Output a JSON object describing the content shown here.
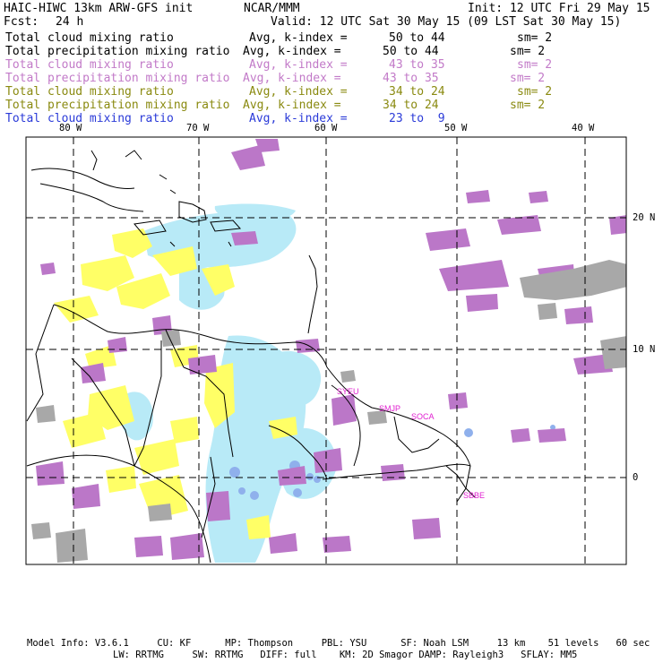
{
  "header": {
    "title": "HAIC-HIWC 13km ARW-GFS init",
    "center": "NCAR/MMM",
    "init": "Init: 12 UTC Fri 29 May 15",
    "fcst_label": "Fcst:",
    "fcst_value": "24 h",
    "valid": "Valid: 12 UTC Sat 30 May 15 (09 LST Sat 30 May 15)"
  },
  "fields": [
    {
      "name": "Total cloud mixing ratio",
      "avg": "Avg, k-index =",
      "range": "50 to 44",
      "sm": "sm= 2",
      "color": "#000000"
    },
    {
      "name": "Total precipitation mixing ratio",
      "avg": "Avg, k-index =",
      "range": "50 to 44",
      "sm": "sm= 2",
      "color": "#000000"
    },
    {
      "name": "Total cloud mixing ratio",
      "avg": "Avg, k-index =",
      "range": "43 to 35",
      "sm": "sm= 2",
      "color": "#c27ac8"
    },
    {
      "name": "Total precipitation mixing ratio",
      "avg": "Avg, k-index =",
      "range": "43 to 35",
      "sm": "sm= 2",
      "color": "#c27ac8"
    },
    {
      "name": "Total cloud mixing ratio",
      "avg": "Avg, k-index =",
      "range": "34 to 24",
      "sm": "sm= 2",
      "color": "#8a8a10"
    },
    {
      "name": "Total precipitation mixing ratio",
      "avg": "Avg, k-index =",
      "range": "34 to 24",
      "sm": "sm= 2",
      "color": "#8a8a10"
    },
    {
      "name": "Total cloud mixing ratio",
      "avg": "Avg, k-index =",
      "range": "23 to  9",
      "sm": "",
      "color": "#2a3ad8"
    }
  ],
  "map": {
    "lon_labels": [
      "80 W",
      "70 W",
      "60 W",
      "50 W",
      "40 W"
    ],
    "lat_labels": [
      "20 N",
      "10 N",
      "0"
    ],
    "stations": [
      {
        "code": "SYEU",
        "color": "#e020d0"
      },
      {
        "code": "SMJP",
        "color": "#e020d0"
      },
      {
        "code": "SOCA",
        "color": "#e020d0"
      },
      {
        "code": "SBBE",
        "color": "#e020d0"
      }
    ],
    "colors": {
      "cloud_low": "#b3e8f6",
      "precip_mid": "#ffff66",
      "cloud_mid": "#bb77c8",
      "gray": "#a8a8a8",
      "blue_core": "#8fb6ee"
    }
  },
  "footer": {
    "line1": "Model Info: V3.6.1     CU: KF      MP: Thompson     PBL: YSU      SF: Noah LSM     13 km    51 levels   60 sec",
    "line2": "LW: RRTMG     SW: RRTMG   DIFF: full    KM: 2D Smagor DAMP: Rayleigh3   SFLAY: MM5"
  }
}
